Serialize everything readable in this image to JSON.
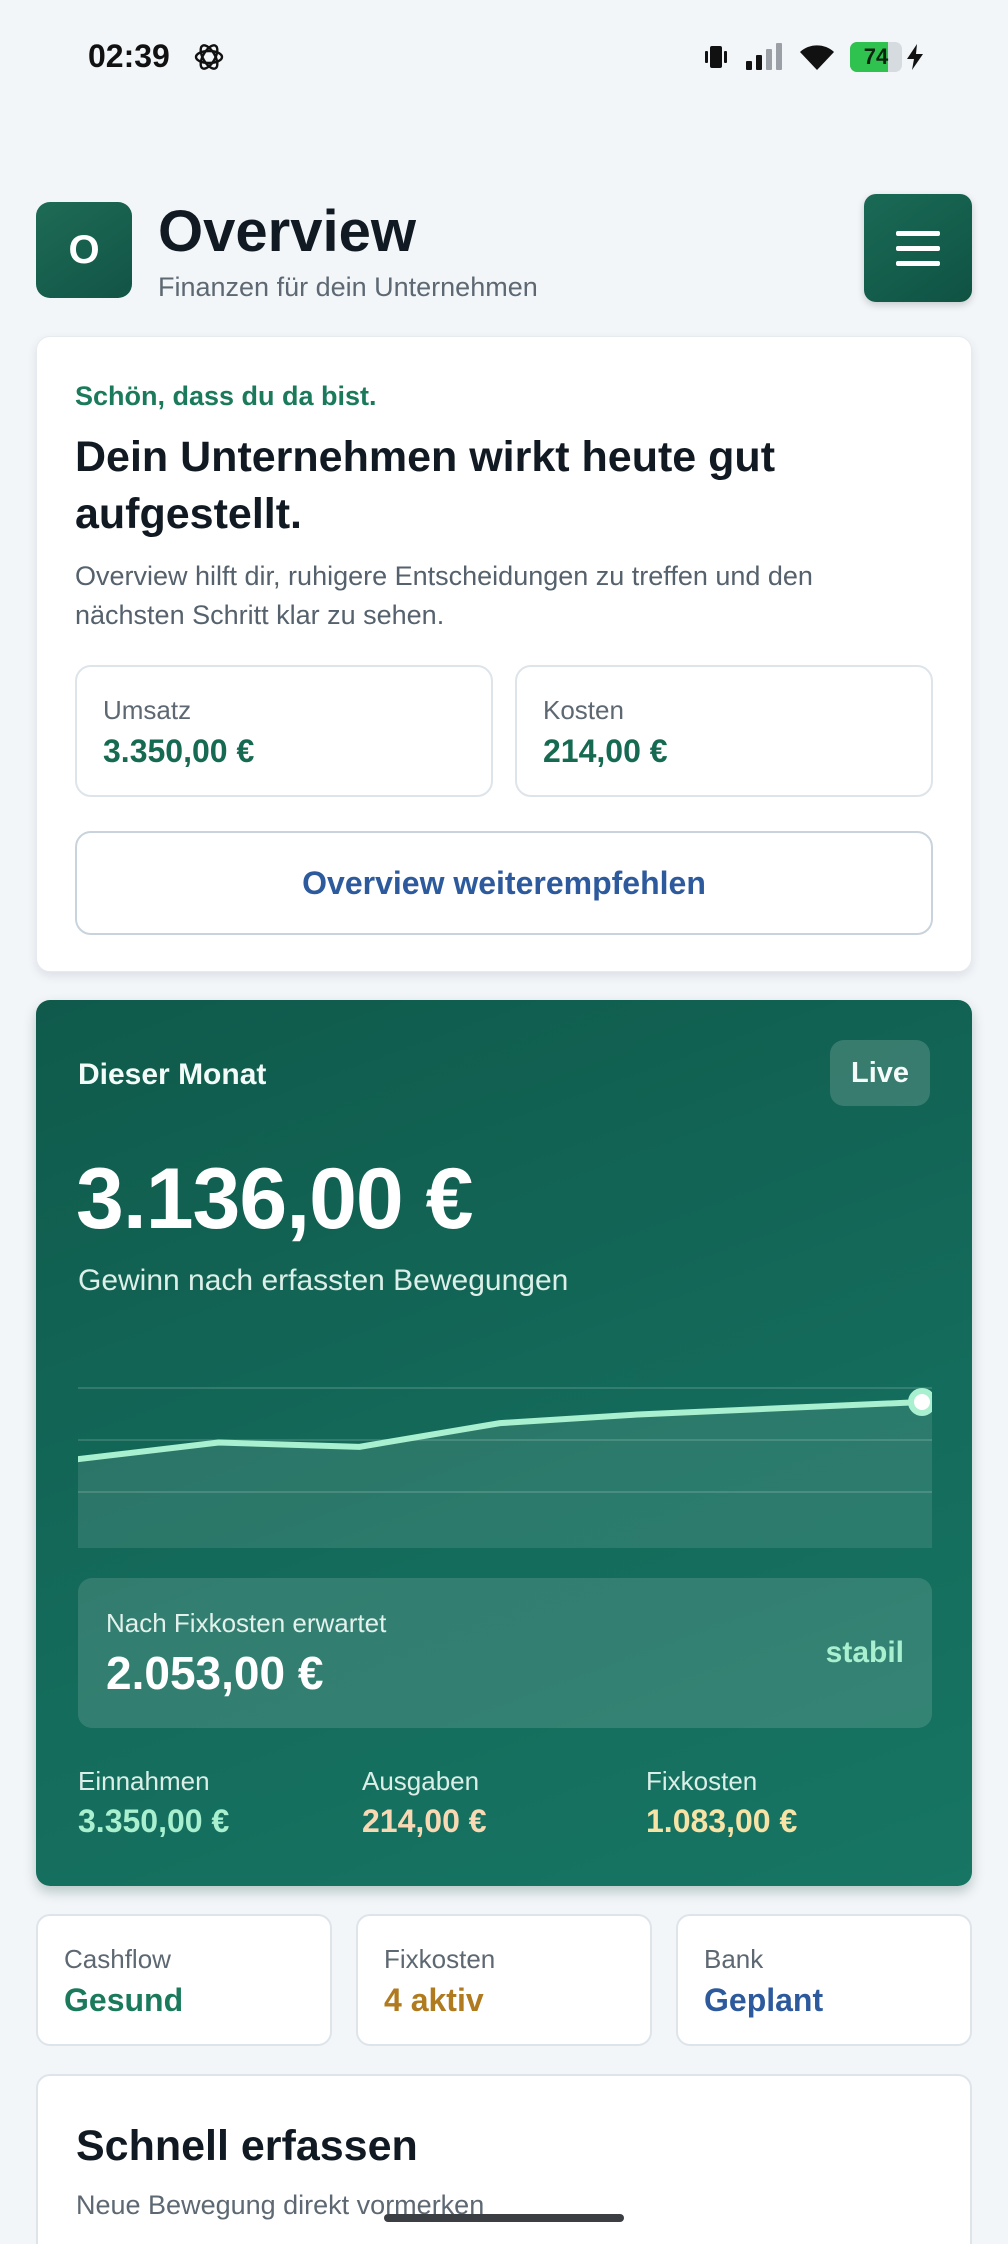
{
  "status_bar": {
    "time": "02:39",
    "app_icon": "openai-icon",
    "battery_percent": "74",
    "battery_level": 0.74,
    "charging": true
  },
  "header": {
    "logo_letter": "O",
    "title": "Overview",
    "subtitle": "Finanzen für dein Unternehmen",
    "menu_icon": "hamburger-icon"
  },
  "welcome": {
    "greeting": "Schön, dass du da bist.",
    "headline": "Dein Unternehmen wirkt heute gut aufgestellt.",
    "text": "Overview hilft dir, ruhigere Entscheidungen zu treffen und den nächsten Schritt klar zu sehen.",
    "kpis": [
      {
        "label": "Umsatz",
        "value": "3.350,00 €"
      },
      {
        "label": "Kosten",
        "value": "214,00 €"
      }
    ],
    "recommend_button": "Overview weiterempfehlen"
  },
  "month": {
    "title": "Dieser Monat",
    "badge": "Live",
    "amount": "3.136,00 €",
    "subtitle": "Gewinn nach erfassten Bewegungen",
    "expected_label": "Nach Fixkosten erwartet",
    "expected_value": "2.053,00 €",
    "expected_status": "stabil",
    "stats": [
      {
        "label": "Einnahmen",
        "value": "3.350,00 €",
        "color": "#a8f0cf"
      },
      {
        "label": "Ausgaben",
        "value": "214,00 €",
        "color": "#f8d9b4"
      },
      {
        "label": "Fixkosten",
        "value": "1.083,00 €",
        "color": "#f7e3a6"
      }
    ]
  },
  "chart_data": {
    "type": "area",
    "x": [
      1,
      2,
      3,
      4,
      5,
      6,
      7
    ],
    "values": [
      0.35,
      0.54,
      0.49,
      0.76,
      0.86,
      0.93,
      1.0
    ],
    "line_color": "#a8f0cf",
    "grid": true
  },
  "tiles": [
    {
      "label": "Cashflow",
      "value": "Gesund",
      "color": "#1b7a5c"
    },
    {
      "label": "Fixkosten",
      "value": "4 aktiv",
      "color": "#b07a1e"
    },
    {
      "label": "Bank",
      "value": "Geplant",
      "color": "#2d5a9c"
    }
  ],
  "quick": {
    "title": "Schnell erfassen",
    "subtitle": "Neue Bewegung direkt vormerken"
  }
}
